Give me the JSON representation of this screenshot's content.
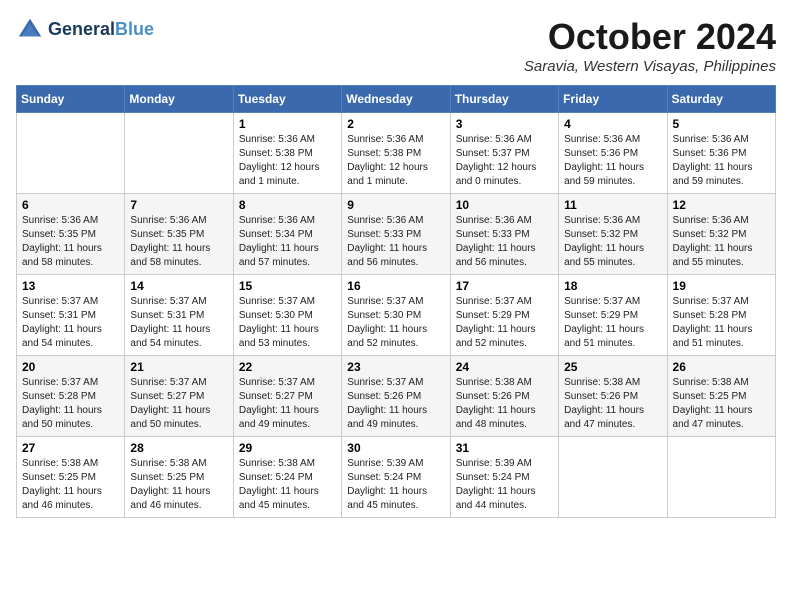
{
  "header": {
    "logo_line1": "General",
    "logo_line2": "Blue",
    "month": "October 2024",
    "location": "Saravia, Western Visayas, Philippines"
  },
  "weekdays": [
    "Sunday",
    "Monday",
    "Tuesday",
    "Wednesday",
    "Thursday",
    "Friday",
    "Saturday"
  ],
  "weeks": [
    [
      {
        "day": "",
        "detail": ""
      },
      {
        "day": "",
        "detail": ""
      },
      {
        "day": "1",
        "detail": "Sunrise: 5:36 AM\nSunset: 5:38 PM\nDaylight: 12 hours\nand 1 minute."
      },
      {
        "day": "2",
        "detail": "Sunrise: 5:36 AM\nSunset: 5:38 PM\nDaylight: 12 hours\nand 1 minute."
      },
      {
        "day": "3",
        "detail": "Sunrise: 5:36 AM\nSunset: 5:37 PM\nDaylight: 12 hours\nand 0 minutes."
      },
      {
        "day": "4",
        "detail": "Sunrise: 5:36 AM\nSunset: 5:36 PM\nDaylight: 11 hours\nand 59 minutes."
      },
      {
        "day": "5",
        "detail": "Sunrise: 5:36 AM\nSunset: 5:36 PM\nDaylight: 11 hours\nand 59 minutes."
      }
    ],
    [
      {
        "day": "6",
        "detail": "Sunrise: 5:36 AM\nSunset: 5:35 PM\nDaylight: 11 hours\nand 58 minutes."
      },
      {
        "day": "7",
        "detail": "Sunrise: 5:36 AM\nSunset: 5:35 PM\nDaylight: 11 hours\nand 58 minutes."
      },
      {
        "day": "8",
        "detail": "Sunrise: 5:36 AM\nSunset: 5:34 PM\nDaylight: 11 hours\nand 57 minutes."
      },
      {
        "day": "9",
        "detail": "Sunrise: 5:36 AM\nSunset: 5:33 PM\nDaylight: 11 hours\nand 56 minutes."
      },
      {
        "day": "10",
        "detail": "Sunrise: 5:36 AM\nSunset: 5:33 PM\nDaylight: 11 hours\nand 56 minutes."
      },
      {
        "day": "11",
        "detail": "Sunrise: 5:36 AM\nSunset: 5:32 PM\nDaylight: 11 hours\nand 55 minutes."
      },
      {
        "day": "12",
        "detail": "Sunrise: 5:36 AM\nSunset: 5:32 PM\nDaylight: 11 hours\nand 55 minutes."
      }
    ],
    [
      {
        "day": "13",
        "detail": "Sunrise: 5:37 AM\nSunset: 5:31 PM\nDaylight: 11 hours\nand 54 minutes."
      },
      {
        "day": "14",
        "detail": "Sunrise: 5:37 AM\nSunset: 5:31 PM\nDaylight: 11 hours\nand 54 minutes."
      },
      {
        "day": "15",
        "detail": "Sunrise: 5:37 AM\nSunset: 5:30 PM\nDaylight: 11 hours\nand 53 minutes."
      },
      {
        "day": "16",
        "detail": "Sunrise: 5:37 AM\nSunset: 5:30 PM\nDaylight: 11 hours\nand 52 minutes."
      },
      {
        "day": "17",
        "detail": "Sunrise: 5:37 AM\nSunset: 5:29 PM\nDaylight: 11 hours\nand 52 minutes."
      },
      {
        "day": "18",
        "detail": "Sunrise: 5:37 AM\nSunset: 5:29 PM\nDaylight: 11 hours\nand 51 minutes."
      },
      {
        "day": "19",
        "detail": "Sunrise: 5:37 AM\nSunset: 5:28 PM\nDaylight: 11 hours\nand 51 minutes."
      }
    ],
    [
      {
        "day": "20",
        "detail": "Sunrise: 5:37 AM\nSunset: 5:28 PM\nDaylight: 11 hours\nand 50 minutes."
      },
      {
        "day": "21",
        "detail": "Sunrise: 5:37 AM\nSunset: 5:27 PM\nDaylight: 11 hours\nand 50 minutes."
      },
      {
        "day": "22",
        "detail": "Sunrise: 5:37 AM\nSunset: 5:27 PM\nDaylight: 11 hours\nand 49 minutes."
      },
      {
        "day": "23",
        "detail": "Sunrise: 5:37 AM\nSunset: 5:26 PM\nDaylight: 11 hours\nand 49 minutes."
      },
      {
        "day": "24",
        "detail": "Sunrise: 5:38 AM\nSunset: 5:26 PM\nDaylight: 11 hours\nand 48 minutes."
      },
      {
        "day": "25",
        "detail": "Sunrise: 5:38 AM\nSunset: 5:26 PM\nDaylight: 11 hours\nand 47 minutes."
      },
      {
        "day": "26",
        "detail": "Sunrise: 5:38 AM\nSunset: 5:25 PM\nDaylight: 11 hours\nand 47 minutes."
      }
    ],
    [
      {
        "day": "27",
        "detail": "Sunrise: 5:38 AM\nSunset: 5:25 PM\nDaylight: 11 hours\nand 46 minutes."
      },
      {
        "day": "28",
        "detail": "Sunrise: 5:38 AM\nSunset: 5:25 PM\nDaylight: 11 hours\nand 46 minutes."
      },
      {
        "day": "29",
        "detail": "Sunrise: 5:38 AM\nSunset: 5:24 PM\nDaylight: 11 hours\nand 45 minutes."
      },
      {
        "day": "30",
        "detail": "Sunrise: 5:39 AM\nSunset: 5:24 PM\nDaylight: 11 hours\nand 45 minutes."
      },
      {
        "day": "31",
        "detail": "Sunrise: 5:39 AM\nSunset: 5:24 PM\nDaylight: 11 hours\nand 44 minutes."
      },
      {
        "day": "",
        "detail": ""
      },
      {
        "day": "",
        "detail": ""
      }
    ]
  ]
}
